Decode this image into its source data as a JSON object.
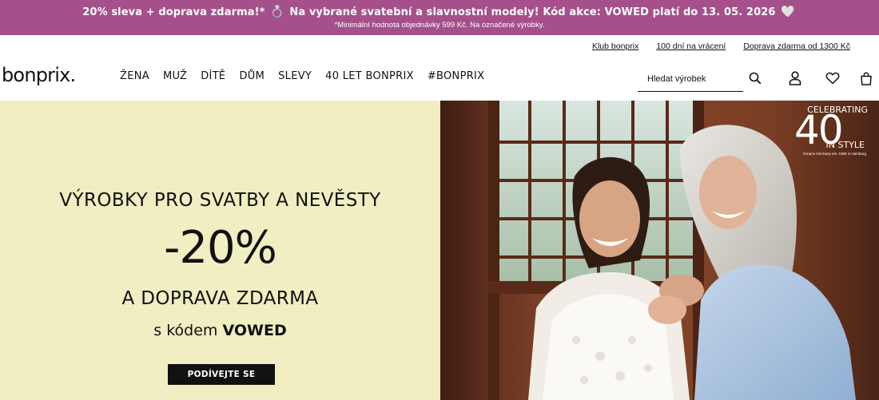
{
  "promo": {
    "main_text_1": "20% sleva + doprava zdarma!*",
    "ring_icon": "💍",
    "main_text_2": "Na vybrané svatební a slavnostní modely! Kód akce: VOWED platí do 13. 05. 2026",
    "heart_icon": "🤍",
    "sub_text": "*Minimální hodnota objednávky 599 Kč. Na označené výrobky.",
    "bg_color": "#a5508a"
  },
  "utility_links": [
    "Klub bonprix",
    "100 dní na vrácení",
    "Doprava zdarma od 1300 Kč"
  ],
  "logo": "bonprix.",
  "nav": [
    "ŽENA",
    "MUŽ",
    "DÍTĚ",
    "DŮM",
    "SLEVY",
    "40 LET BONPRIX",
    "#BONPRIX"
  ],
  "search": {
    "placeholder": "Hledat výrobek"
  },
  "icons": [
    "search-icon",
    "account-icon",
    "heart-icon",
    "bag-icon"
  ],
  "hero": {
    "title": "VÝROBKY PRO SVATBY A NEVĚSTY",
    "percent": "-20%",
    "subtitle": "A DOPRAVA ZDARMA",
    "code_prefix": "s kódem",
    "code": "VOWED",
    "cta": "PODÍVEJTE SE",
    "bg_color": "#f0eec2"
  },
  "badge": {
    "top": "CELEBRATING",
    "number": "40",
    "bottom": "IN STYLE",
    "small": "bonprix Germany est. 1986 in Hamburg"
  }
}
